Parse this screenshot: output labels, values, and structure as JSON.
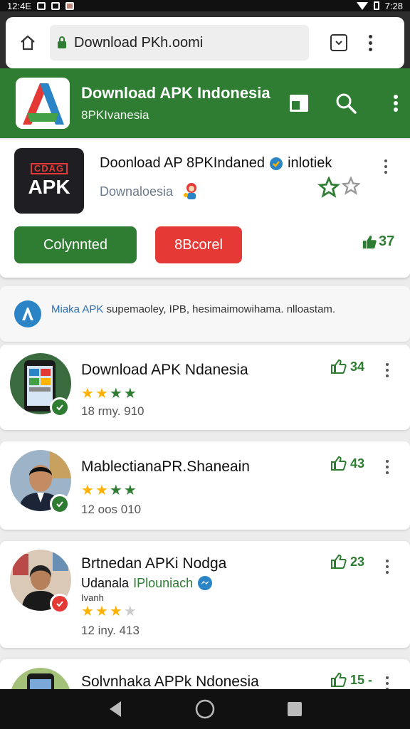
{
  "status_bar": {
    "time_left": "12:4E",
    "time_right": "7:28"
  },
  "browser": {
    "url": "Download PKh.oomi"
  },
  "app_bar": {
    "title": "Download APK Indonesia",
    "subtitle": "8PKIvanesia"
  },
  "featured": {
    "icon_top": "CDAG",
    "icon_text": "APK",
    "title": "Doonload AP 8PKIndaned",
    "title_suffix": "inlotiek",
    "subtitle": "Downaloesia",
    "primary_button": "Colynnted",
    "secondary_button": "8Bcorel",
    "count": "37"
  },
  "info": {
    "brand": "Miaka APK",
    "text": "supemaoley, IPB, hesimaimowihama. nlloastam."
  },
  "items": [
    {
      "title": "Download APK Ndanesia",
      "rating": 4,
      "meta": "18 rmy. 910",
      "count": "34"
    },
    {
      "title": "MablectianaPR.Shaneain",
      "rating": 4,
      "meta": "12 oos 010",
      "count": "43"
    },
    {
      "title": "Brtnedan APKi Nodga",
      "subtitle": "Udanala",
      "subtitle_link": "IPlouniach",
      "subtitle2": "Ivanh",
      "rating": 3,
      "meta": "12 iny. 413",
      "count": "23"
    },
    {
      "title": "Solvnhaka APPk Ndonesia",
      "count": "15 -"
    }
  ],
  "colors": {
    "brand_green": "#2e7d32",
    "accent_red": "#e53935",
    "accent_blue": "#2b84c6"
  }
}
